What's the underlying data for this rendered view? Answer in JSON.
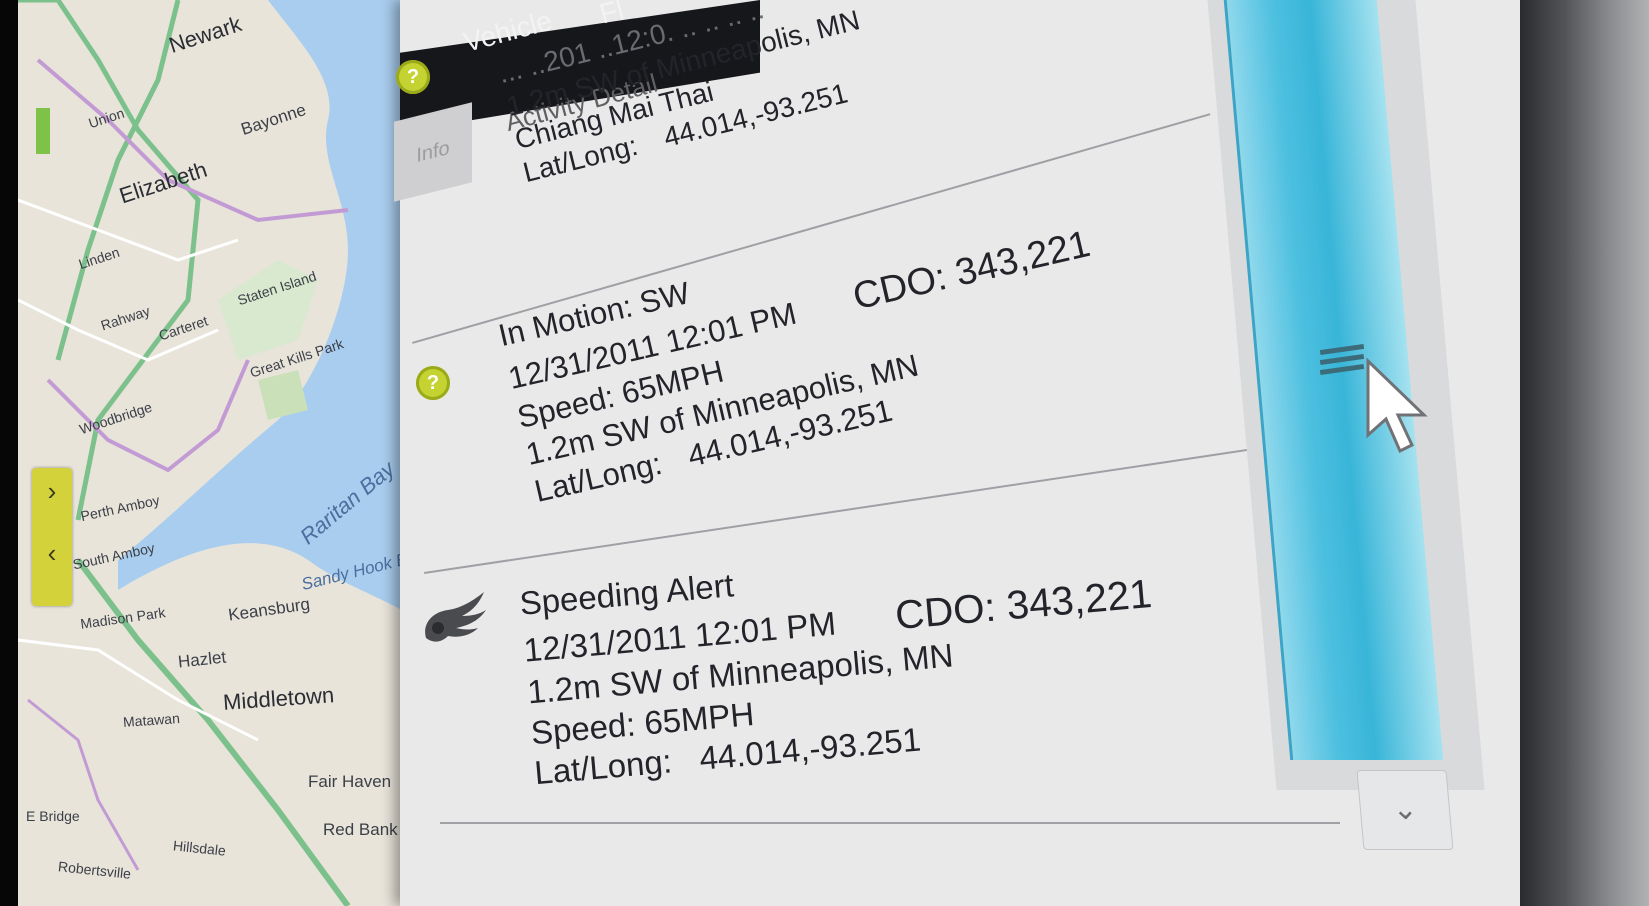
{
  "header": {
    "tabs": [
      {
        "label": "Vehicle"
      },
      {
        "label": "Fl"
      },
      {
        "label": "Info"
      },
      {
        "label": "Activity Detail"
      }
    ]
  },
  "map": {
    "labels": [
      {
        "text": "Newark",
        "kind": "city"
      },
      {
        "text": "Elizabeth",
        "kind": "city"
      },
      {
        "text": "Bayonne",
        "kind": "normal"
      },
      {
        "text": "Union",
        "kind": "small"
      },
      {
        "text": "Linden",
        "kind": "small"
      },
      {
        "text": "Rahway",
        "kind": "small"
      },
      {
        "text": "Carteret",
        "kind": "small"
      },
      {
        "text": "Staten Island",
        "kind": "small"
      },
      {
        "text": "Great Kills Park",
        "kind": "small"
      },
      {
        "text": "Woodbridge",
        "kind": "small"
      },
      {
        "text": "Perth Amboy",
        "kind": "small"
      },
      {
        "text": "South Amboy",
        "kind": "small"
      },
      {
        "text": "Raritan Bay",
        "kind": "water"
      },
      {
        "text": "Sandy Hook Bay",
        "kind": "water"
      },
      {
        "text": "Madison Park",
        "kind": "small"
      },
      {
        "text": "Keansburg",
        "kind": "normal"
      },
      {
        "text": "Hazlet",
        "kind": "normal"
      },
      {
        "text": "Middletown",
        "kind": "city"
      },
      {
        "text": "Matawan",
        "kind": "small"
      },
      {
        "text": "Fair Haven",
        "kind": "normal"
      },
      {
        "text": "Red Bank",
        "kind": "normal"
      },
      {
        "text": "Hillsdale",
        "kind": "small"
      },
      {
        "text": "Robertsville",
        "kind": "small"
      },
      {
        "text": "E Bridge",
        "kind": "small"
      }
    ],
    "nav_up": "›",
    "nav_down": "‹"
  },
  "entries": [
    {
      "lines": [
        "... ..201 ..12:0. .. ..  .. ..",
        "1.2m SW of Minneapolis, MN",
        "Chiang Mai Thai"
      ],
      "latlong_label": "Lat/Long:",
      "latlong_value": "44.014,-93.251"
    },
    {
      "title": "In Motion: SW",
      "datetime": "12/31/2011 12:01 PM",
      "cdo": "CDO: 343,221",
      "speed": "Speed: 65MPH",
      "location": "1.2m SW of Minneapolis, MN",
      "latlong_label": "Lat/Long:",
      "latlong_value": "44.014,-93.251"
    },
    {
      "title": "Speeding Alert",
      "datetime": "12/31/2011 12:01 PM",
      "cdo": "CDO: 343,221",
      "location": "1.2m SW of Minneapolis, MN",
      "speed": "Speed: 65MPH",
      "latlong_label": "Lat/Long:",
      "latlong_value": "44.014,-93.251"
    }
  ],
  "scroll": {
    "down_glyph": "⌄",
    "position_fraction": 0.42
  },
  "colors": {
    "accent_lime": "#c4d331",
    "scroll_blue": "#4ec0e0",
    "water": "#a9cdee"
  }
}
